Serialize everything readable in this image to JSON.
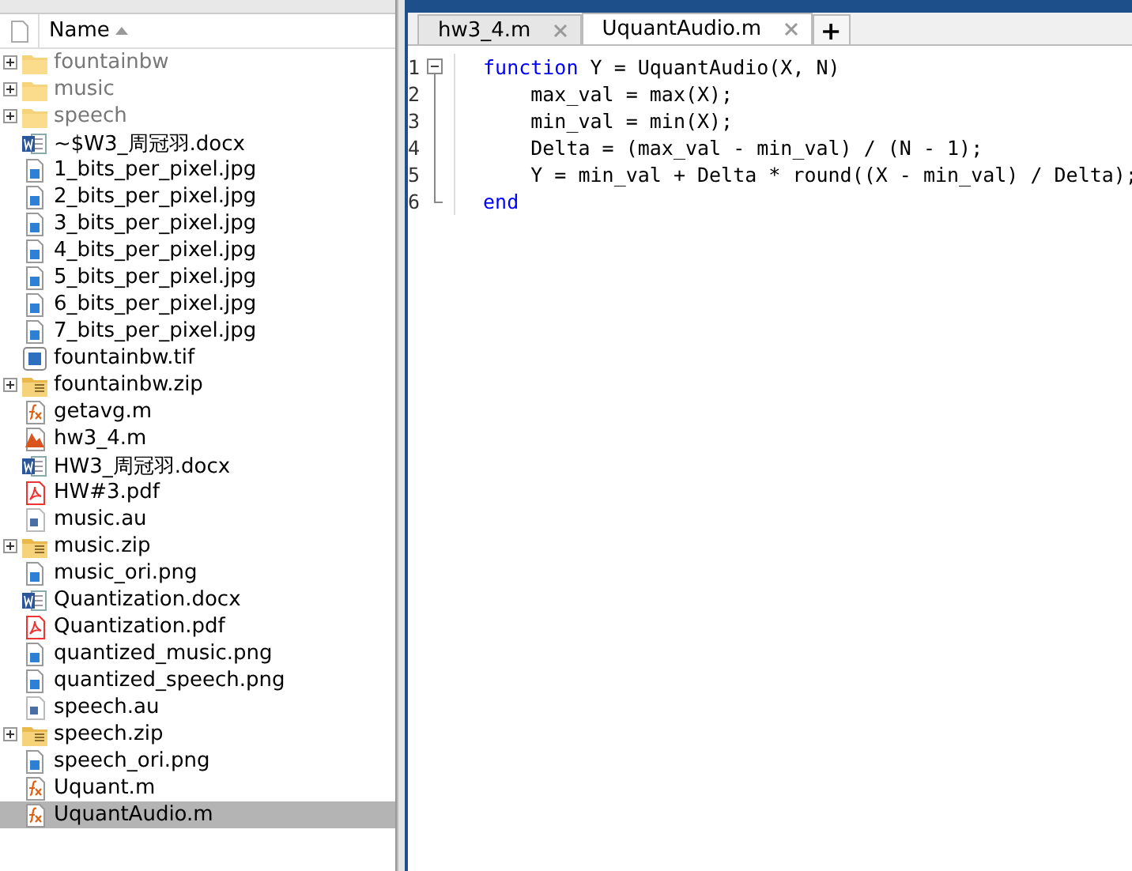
{
  "folder_panel": {
    "column_header": "Name",
    "sorted_ascending": true,
    "files": [
      {
        "name": "fountainbw",
        "kind": "folder",
        "expandable": true,
        "selected": false
      },
      {
        "name": "music",
        "kind": "folder",
        "expandable": true,
        "selected": false
      },
      {
        "name": "speech",
        "kind": "folder",
        "expandable": true,
        "selected": false
      },
      {
        "name": "~$W3_周冠羽.docx",
        "kind": "docx",
        "expandable": false,
        "selected": false
      },
      {
        "name": "1_bits_per_pixel.jpg",
        "kind": "image",
        "expandable": false,
        "selected": false
      },
      {
        "name": "2_bits_per_pixel.jpg",
        "kind": "image",
        "expandable": false,
        "selected": false
      },
      {
        "name": "3_bits_per_pixel.jpg",
        "kind": "image",
        "expandable": false,
        "selected": false
      },
      {
        "name": "4_bits_per_pixel.jpg",
        "kind": "image",
        "expandable": false,
        "selected": false
      },
      {
        "name": "5_bits_per_pixel.jpg",
        "kind": "image",
        "expandable": false,
        "selected": false
      },
      {
        "name": "6_bits_per_pixel.jpg",
        "kind": "image",
        "expandable": false,
        "selected": false
      },
      {
        "name": "7_bits_per_pixel.jpg",
        "kind": "image",
        "expandable": false,
        "selected": false
      },
      {
        "name": "fountainbw.tif",
        "kind": "tif",
        "expandable": false,
        "selected": false
      },
      {
        "name": "fountainbw.zip",
        "kind": "zip",
        "expandable": true,
        "selected": false
      },
      {
        "name": "getavg.m",
        "kind": "function",
        "expandable": false,
        "selected": false
      },
      {
        "name": "hw3_4.m",
        "kind": "script",
        "expandable": false,
        "selected": false
      },
      {
        "name": "HW3_周冠羽.docx",
        "kind": "docx",
        "expandable": false,
        "selected": false
      },
      {
        "name": "HW#3.pdf",
        "kind": "pdf",
        "expandable": false,
        "selected": false
      },
      {
        "name": "music.au",
        "kind": "audio",
        "expandable": false,
        "selected": false
      },
      {
        "name": "music.zip",
        "kind": "zip",
        "expandable": true,
        "selected": false
      },
      {
        "name": "music_ori.png",
        "kind": "image",
        "expandable": false,
        "selected": false
      },
      {
        "name": "Quantization.docx",
        "kind": "docx",
        "expandable": false,
        "selected": false
      },
      {
        "name": "Quantization.pdf",
        "kind": "pdf",
        "expandable": false,
        "selected": false
      },
      {
        "name": "quantized_music.png",
        "kind": "image",
        "expandable": false,
        "selected": false
      },
      {
        "name": "quantized_speech.png",
        "kind": "image",
        "expandable": false,
        "selected": false
      },
      {
        "name": "speech.au",
        "kind": "audio",
        "expandable": false,
        "selected": false
      },
      {
        "name": "speech.zip",
        "kind": "zip",
        "expandable": true,
        "selected": false
      },
      {
        "name": "speech_ori.png",
        "kind": "image",
        "expandable": false,
        "selected": false
      },
      {
        "name": "Uquant.m",
        "kind": "function",
        "expandable": false,
        "selected": false
      },
      {
        "name": "UquantAudio.m",
        "kind": "function",
        "expandable": false,
        "selected": true
      }
    ]
  },
  "editor": {
    "tabs": [
      {
        "label": "hw3_4.m",
        "selected": false
      },
      {
        "label": "UquantAudio.m",
        "selected": true
      }
    ],
    "new_tab": "+",
    "lines": [
      {
        "number": "1",
        "segments": [
          {
            "text": "function",
            "kind": "keyword"
          },
          {
            "text": " Y = UquantAudio(X, N)",
            "kind": "code"
          }
        ]
      },
      {
        "number": "2",
        "segments": [
          {
            "text": "    max_val = max(X);",
            "kind": "code"
          }
        ]
      },
      {
        "number": "3",
        "segments": [
          {
            "text": "    min_val = min(X);",
            "kind": "code"
          }
        ]
      },
      {
        "number": "4",
        "segments": [
          {
            "text": "    Delta = (max_val - min_val) / (N - 1);",
            "kind": "code"
          }
        ]
      },
      {
        "number": "5",
        "segments": [
          {
            "text": "    Y = min_val + Delta * round((X - min_val) / Delta);",
            "kind": "code"
          }
        ]
      },
      {
        "number": "6",
        "segments": [
          {
            "text": "end",
            "kind": "keyword"
          }
        ]
      }
    ]
  }
}
